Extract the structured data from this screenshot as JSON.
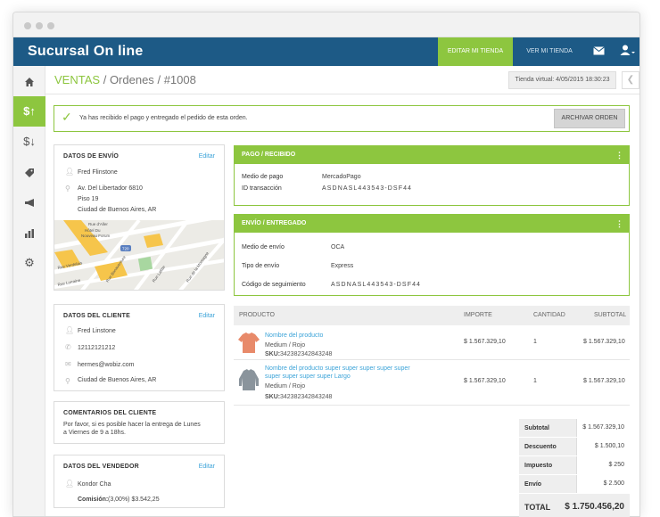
{
  "app": {
    "brand": "Sucursal On line",
    "edit_store": "EDITAR MI TIENDA",
    "view_store": "VER MI TIENDA"
  },
  "breadcrumb": {
    "section": "VENTAS",
    "sep1": "/",
    "sub": "Ordenes",
    "sep2": "/",
    "order": "#1008"
  },
  "store_time": "Tienda virtual: 4/05/2015 18:30:23",
  "alert": {
    "message": "Ya has recibido el pago y entregado el pedido de esta orden.",
    "archive_label": "ARCHIVAR ORDEN"
  },
  "shipping": {
    "title": "DATOS DE ENVÍO",
    "edit": "Editar",
    "name": "Fred Flinstone",
    "address": "Av. Del Libertador 6810",
    "floor": "Piso 19",
    "city": "Ciudad de Buenos Aires, AR"
  },
  "map_labels": [
    "Rue d'Aller",
    "Hôtel Du",
    "Nouveau Forum",
    "Rue Verdelais",
    "Rue Lorraine",
    "Rue Bonaventure",
    "Rue Lafitte",
    "Rue de la Montagne",
    "720"
  ],
  "customer": {
    "title": "DATOS DEL CLIENTE",
    "edit": "Editar",
    "name": "Fred Linstone",
    "phone": "12112121212",
    "email": "hermes@wobiz.com",
    "city": "Ciudad de Buenos Aires, AR"
  },
  "comments": {
    "title": "COMENTARIOS DEL CLIENTE",
    "text_line1": "Por favor, si es posible hacer la entrega de Lunes",
    "text_line2": "a Viernes de 9 a 18hs."
  },
  "seller": {
    "title": "DATOS DEL VENDEDOR",
    "edit": "Editar",
    "name": "Kondor Cha",
    "commission_label": "Comisión:",
    "commission_value": "(3,00%) $3.542,25"
  },
  "payment": {
    "title": "PAGO / RECIBIDO",
    "method_label": "Medio de pago",
    "method_value": "MercadoPago",
    "tx_label": "ID transacción",
    "tx_value": "ASDNASL443543-DSF44"
  },
  "shipment": {
    "title": "ENVÍO / ENTREGADO",
    "method_label": "Medio de envío",
    "method_value": "OCA",
    "type_label": "Tipo de envío",
    "type_value": "Express",
    "tracking_label": "Código de seguimiento",
    "tracking_value": "ASDNASL443543-DSF44"
  },
  "products_table": {
    "headers": {
      "product": "PRODUCTO",
      "amount": "IMPORTE",
      "qty": "CANTIDAD",
      "subtotal": "SUBTOTAL"
    },
    "rows": [
      {
        "name": "Nombre del producto",
        "variant": "Medium / Rojo",
        "sku_label": "SKU:",
        "sku": "342382342843248",
        "amount": "$ 1.567.329,10",
        "qty": "1",
        "subtotal": "$ 1.567.329,10"
      },
      {
        "name": "Nombre del producto super super super super super super super super super Largo",
        "variant": "Medium / Rojo",
        "sku_label": "SKU:",
        "sku": "342382342843248",
        "amount": "$ 1.567.329,10",
        "qty": "1",
        "subtotal": "$ 1.567.329,10"
      }
    ]
  },
  "totals": {
    "subtotal_label": "Subtotal",
    "subtotal": "$ 1.567.329,10",
    "discount_label": "Descuento",
    "discount": "$ 1.500,10",
    "tax_label": "Impuesto",
    "tax": "$ 250",
    "shipping_label": "Envío",
    "shipping": "$ 2.500",
    "total_label": "TOTAL",
    "total": "$ 1.750.456,20"
  },
  "colors": {
    "accent": "#8dc63f",
    "topbar": "#1d5a86",
    "link": "#3ba3d8"
  }
}
